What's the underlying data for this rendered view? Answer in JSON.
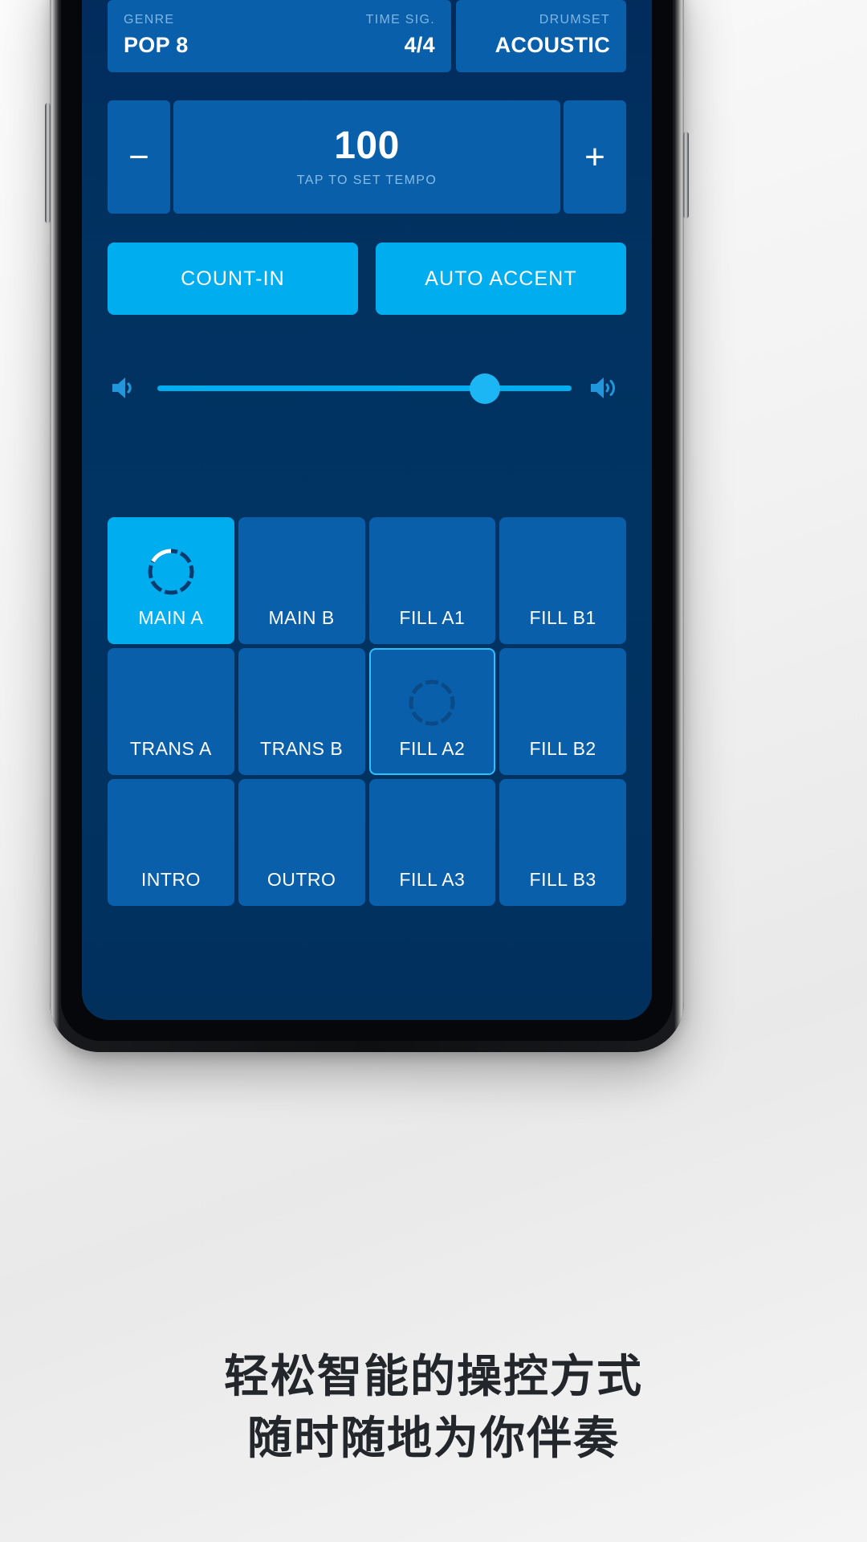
{
  "app": {
    "info_bar": [
      {
        "label": "GENRE",
        "value": "POP 8",
        "align": "left"
      },
      {
        "label": "TIME SIG.",
        "value": "4/4",
        "align": "right"
      },
      {
        "label": "DRUMSET",
        "value": "ACOUSTIC",
        "align": "right"
      }
    ],
    "tempo": {
      "minus_label": "−",
      "plus_label": "+",
      "value": "100",
      "hint": "TAP TO SET TEMPO"
    },
    "toggles": [
      {
        "label": "COUNT-IN",
        "state": "on"
      },
      {
        "label": "AUTO ACCENT",
        "state": "on"
      }
    ],
    "volume": {
      "min_icon": "speaker-low-icon",
      "max_icon": "speaker-high-icon",
      "percent": 79
    },
    "pads": [
      {
        "label": "MAIN A",
        "state": "active",
        "ring": "playing"
      },
      {
        "label": "MAIN B",
        "state": "idle",
        "ring": "none"
      },
      {
        "label": "FILL A1",
        "state": "idle",
        "ring": "none"
      },
      {
        "label": "FILL B1",
        "state": "idle",
        "ring": "none"
      },
      {
        "label": "TRANS A",
        "state": "idle",
        "ring": "none"
      },
      {
        "label": "TRANS B",
        "state": "idle",
        "ring": "none"
      },
      {
        "label": "FILL A2",
        "state": "queued",
        "ring": "queued"
      },
      {
        "label": "FILL B2",
        "state": "idle",
        "ring": "none"
      },
      {
        "label": "INTRO",
        "state": "idle",
        "ring": "none"
      },
      {
        "label": "OUTRO",
        "state": "idle",
        "ring": "none"
      },
      {
        "label": "FILL A3",
        "state": "idle",
        "ring": "none"
      },
      {
        "label": "FILL B3",
        "state": "idle",
        "ring": "none"
      }
    ],
    "colors": {
      "screen_background": "#01315f",
      "panel": "#0a5fab",
      "accent": "#00aef0",
      "accent_bright": "#2bc0ff",
      "label_muted": "#7fb6e3",
      "text": "#ffffff"
    }
  },
  "caption": {
    "line1": "轻松智能的操控方式",
    "line2": "随时随地为你伴奏"
  }
}
